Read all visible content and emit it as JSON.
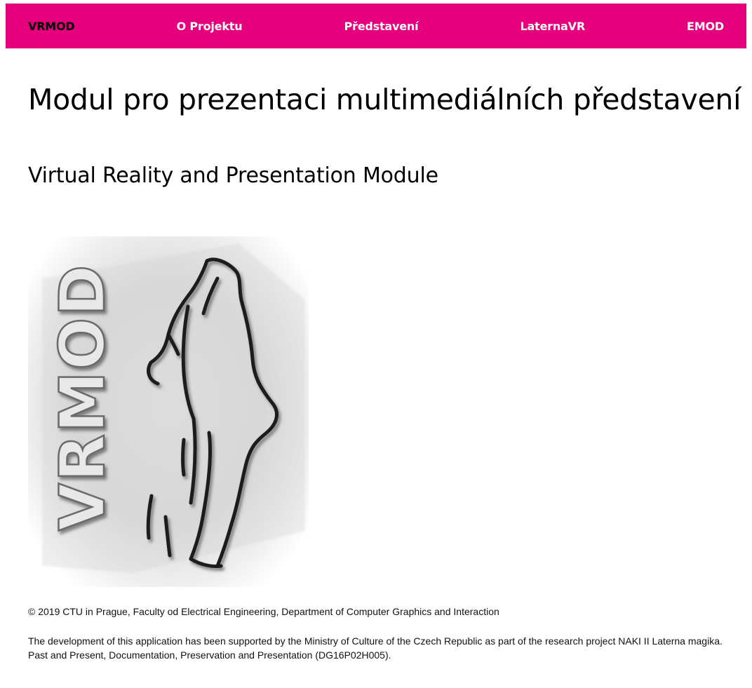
{
  "nav": {
    "brand": "VRMOD",
    "items": [
      {
        "label": "O Projektu"
      },
      {
        "label": "Představení"
      },
      {
        "label": "LaternaVR"
      },
      {
        "label": "EMOD"
      }
    ]
  },
  "main": {
    "title": "Modul pro prezentaci multimediálních představení",
    "subtitle": "Virtual Reality and Presentation Module",
    "logo_text": "VRMOD"
  },
  "footer": {
    "copyright": "© 2019 CTU in Prague, Faculty od Electrical Engineering, Department of Computer Graphics and Interaction",
    "support": "The development of this application has been supported by the Ministry of Culture of the Czech Republic as part of the research project NAKI II Laterna magika. Past and Present, Documentation, Preservation and Presentation (DG16P02H005)."
  },
  "colors": {
    "nav_background": "#e6007e",
    "nav_text": "#ffffff",
    "brand_text": "#000000"
  }
}
